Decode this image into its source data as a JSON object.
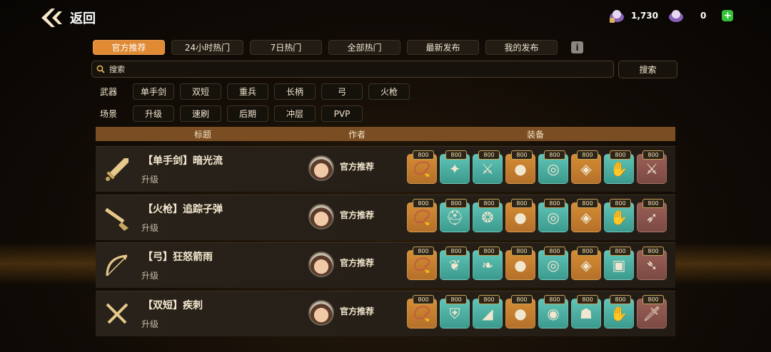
{
  "header": {
    "back_label": "返回",
    "currency_1": {
      "icon": "pearl-locked-icon",
      "value": "1,730"
    },
    "currency_2": {
      "icon": "pearl-icon",
      "value": "0"
    },
    "add_icon": "plus-icon"
  },
  "tabs": [
    {
      "label": "官方推荐",
      "active": true
    },
    {
      "label": "24小时热门",
      "active": false
    },
    {
      "label": "7日热门",
      "active": false
    },
    {
      "label": "全部热门",
      "active": false
    },
    {
      "label": "最新发布",
      "active": false
    },
    {
      "label": "我的发布",
      "active": false
    }
  ],
  "info_icon": "i",
  "search": {
    "placeholder": "搜索",
    "value": "",
    "button": "搜索"
  },
  "filters": {
    "weapon": {
      "label": "武器",
      "options": [
        "单手剑",
        "双短",
        "重兵",
        "长柄",
        "弓",
        "火枪"
      ]
    },
    "scene": {
      "label": "场景",
      "options": [
        "升级",
        "速刷",
        "后期",
        "冲层",
        "PVP"
      ]
    }
  },
  "table": {
    "headers": {
      "title": "标题",
      "author": "作者",
      "equipment": "装备"
    },
    "rows": [
      {
        "title": "【单手剑】暗光流",
        "tag": "升级",
        "author": "官方推荐",
        "weapon_icon": "sword-icon",
        "slots": [
          {
            "badge": "800",
            "quality": "orange",
            "icon": "necklace-icon",
            "glyph": "📿"
          },
          {
            "badge": "800",
            "quality": "teal",
            "icon": "purple-star-icon",
            "glyph": "✦"
          },
          {
            "badge": "800",
            "quality": "teal",
            "icon": "purple-mace-icon",
            "glyph": "⚔"
          },
          {
            "badge": "800",
            "quality": "orange",
            "icon": "bomb-icon",
            "glyph": "●"
          },
          {
            "badge": "800",
            "quality": "teal",
            "icon": "ring-icon",
            "glyph": "◎"
          },
          {
            "badge": "800",
            "quality": "orange",
            "icon": "bracer-icon",
            "glyph": "◈"
          },
          {
            "badge": "800",
            "quality": "teal",
            "icon": "purple-gloves-icon",
            "glyph": "✋"
          },
          {
            "badge": "800",
            "quality": "brown",
            "icon": "blade-icon",
            "glyph": "⚔"
          }
        ]
      },
      {
        "title": "【火枪】追踪子弹",
        "tag": "升级",
        "author": "官方推荐",
        "weapon_icon": "musket-icon",
        "slots": [
          {
            "badge": "800",
            "quality": "orange",
            "icon": "necklace-icon",
            "glyph": "📿"
          },
          {
            "badge": "800",
            "quality": "teal",
            "icon": "helmet-icon",
            "glyph": "⛑"
          },
          {
            "badge": "800",
            "quality": "teal",
            "icon": "shell-icon",
            "glyph": "❂"
          },
          {
            "badge": "800",
            "quality": "orange",
            "icon": "bomb-icon",
            "glyph": "●"
          },
          {
            "badge": "800",
            "quality": "teal",
            "icon": "ring-icon",
            "glyph": "◎"
          },
          {
            "badge": "800",
            "quality": "orange",
            "icon": "bracer-icon",
            "glyph": "◈"
          },
          {
            "badge": "800",
            "quality": "teal",
            "icon": "gloves-icon",
            "glyph": "✋"
          },
          {
            "badge": "800",
            "quality": "brown",
            "icon": "rifle-icon",
            "glyph": "➶"
          }
        ]
      },
      {
        "title": "【弓】狂怒箭雨",
        "tag": "升级",
        "author": "官方推荐",
        "weapon_icon": "bow-icon",
        "slots": [
          {
            "badge": "800",
            "quality": "orange",
            "icon": "necklace-icon",
            "glyph": "📿"
          },
          {
            "badge": "800",
            "quality": "teal",
            "icon": "leaf-armor-icon",
            "glyph": "❦"
          },
          {
            "badge": "800",
            "quality": "teal",
            "icon": "leaf-icon",
            "glyph": "❧"
          },
          {
            "badge": "800",
            "quality": "orange",
            "icon": "bomb-icon",
            "glyph": "●"
          },
          {
            "badge": "800",
            "quality": "teal",
            "icon": "ring-icon",
            "glyph": "◎"
          },
          {
            "badge": "800",
            "quality": "orange",
            "icon": "bracer-icon",
            "glyph": "◈"
          },
          {
            "badge": "800",
            "quality": "teal",
            "icon": "vest-icon",
            "glyph": "▣"
          },
          {
            "badge": "800",
            "quality": "brown",
            "icon": "crossbow-icon",
            "glyph": "➴"
          }
        ]
      },
      {
        "title": "【双短】疾刺",
        "tag": "升级",
        "author": "官方推荐",
        "weapon_icon": "dual-daggers-icon",
        "slots": [
          {
            "badge": "800",
            "quality": "orange",
            "icon": "necklace-icon",
            "glyph": "📿"
          },
          {
            "badge": "800",
            "quality": "teal",
            "icon": "dark-armor-icon",
            "glyph": "⛨"
          },
          {
            "badge": "800",
            "quality": "teal",
            "icon": "boot-icon",
            "glyph": "◢"
          },
          {
            "badge": "800",
            "quality": "orange",
            "icon": "bomb-icon",
            "glyph": "●"
          },
          {
            "badge": "800",
            "quality": "teal",
            "icon": "dark-ring-icon",
            "glyph": "◉"
          },
          {
            "badge": "800",
            "quality": "teal",
            "icon": "mask-icon",
            "glyph": "☗"
          },
          {
            "badge": "800",
            "quality": "teal",
            "icon": "dark-gloves-icon",
            "glyph": "✋"
          },
          {
            "badge": "800",
            "quality": "brown",
            "icon": "red-dagger-icon",
            "glyph": "🗡"
          }
        ]
      }
    ]
  },
  "colors": {
    "accent": "#e08a34",
    "header_bar": "#7a4d22",
    "slot_orange": "#d48d34",
    "slot_teal": "#5fc4b6",
    "slot_brown": "#9a5f56",
    "add_green": "#33c23a"
  }
}
